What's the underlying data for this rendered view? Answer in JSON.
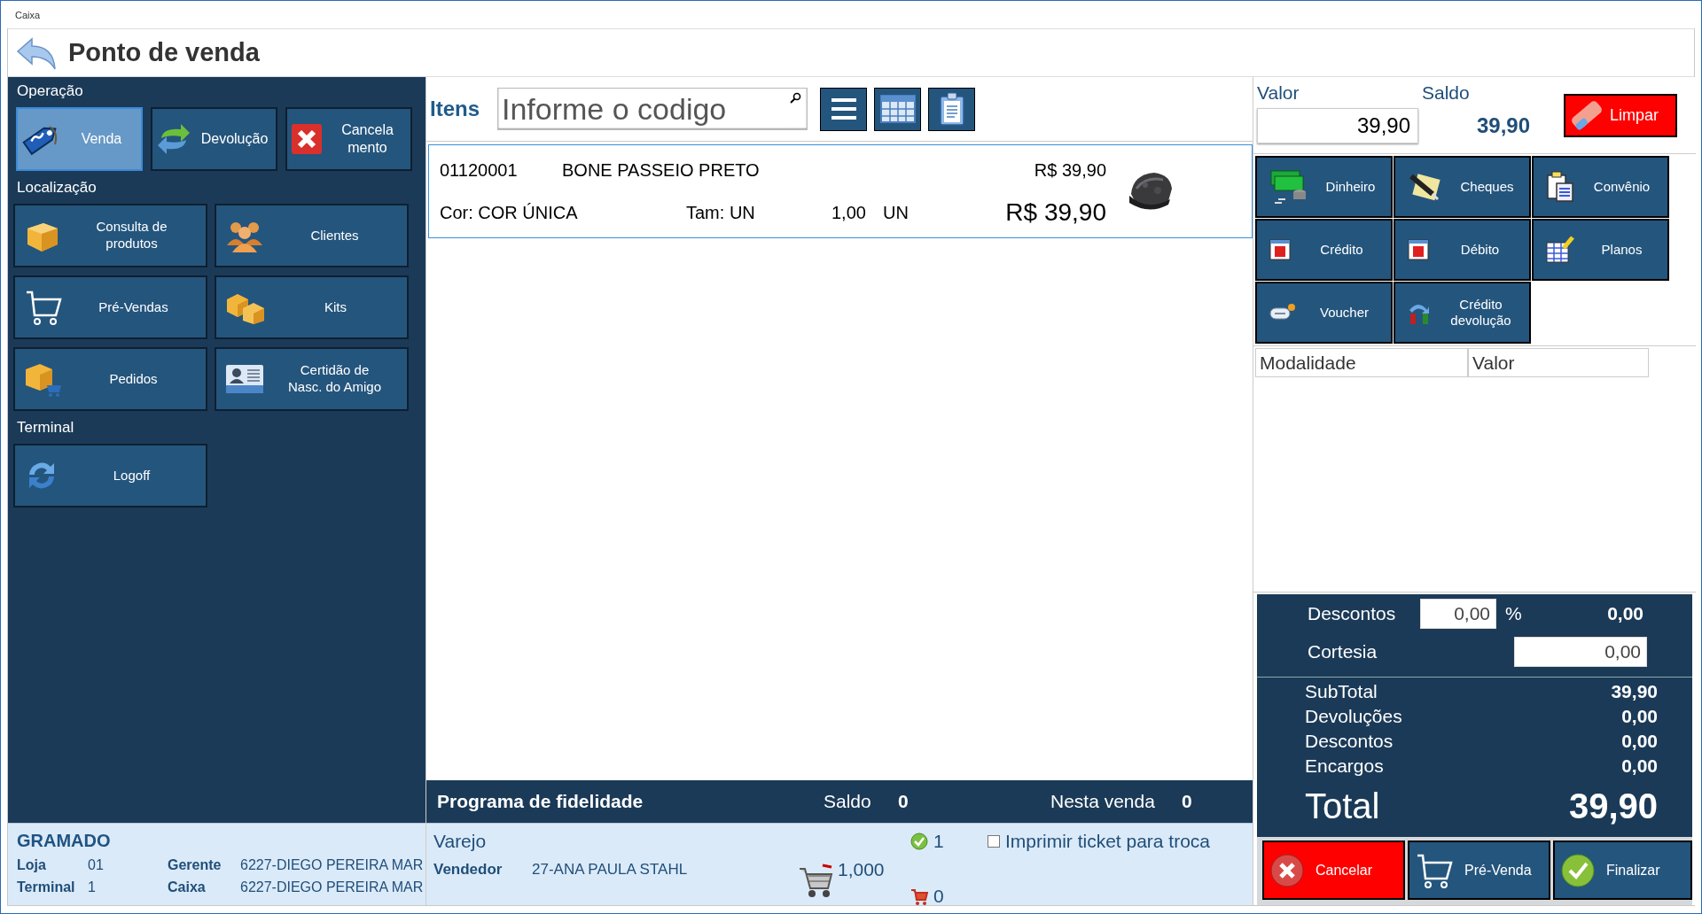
{
  "window": {
    "title": "Caixa"
  },
  "header": {
    "title": "Ponto de venda"
  },
  "sidebar": {
    "sections": [
      {
        "title": "Operação",
        "buttons": [
          {
            "label": "Venda",
            "selected": true
          },
          {
            "label": "Devolução",
            "selected": false
          },
          {
            "label": "Cancela\nmento",
            "selected": false
          }
        ]
      },
      {
        "title": "Localização",
        "buttons": [
          {
            "label": "Consulta de\nprodutos",
            "selected": false
          },
          {
            "label": "Pré-Vendas",
            "selected": false
          },
          {
            "label": "Pedidos",
            "selected": false
          },
          {
            "label": "Clientes",
            "selected": false
          },
          {
            "label": "Kits",
            "selected": false
          },
          {
            "label": "Certidão de\nNasc. do Amigo",
            "selected": false
          }
        ]
      },
      {
        "title": "Terminal",
        "buttons": [
          {
            "label": "Logoff",
            "selected": false
          }
        ]
      }
    ]
  },
  "store": {
    "name": "GRAMADO",
    "fields": [
      {
        "label": "Loja",
        "value": "01"
      },
      {
        "label": "Gerente",
        "value": "6227-DIEGO PEREIRA MAR"
      },
      {
        "label": "Terminal",
        "value": "1"
      },
      {
        "label": "Caixa",
        "value": "6227-DIEGO PEREIRA MAR"
      }
    ]
  },
  "items": {
    "title": "Itens",
    "search": {
      "placeholder": "Informe o codigo"
    },
    "rows": [
      {
        "code": "01120001",
        "description": "BONE PASSEIO PRETO",
        "unit_price": "R$ 39,90",
        "variant": "Cor: COR ÚNICA",
        "size": "Tam: UN",
        "quantity": "1,00",
        "unit": "UN",
        "total": "R$ 39,90",
        "selected": true
      }
    ]
  },
  "loyalty": {
    "title": "Programa de fidelidade",
    "balance_label": "Saldo",
    "balance": "0",
    "sale_label": "Nesta venda",
    "sale": "0"
  },
  "sale": {
    "price_table": "Varejo",
    "seller_label": "Vendedor",
    "seller": "27-ANA PAULA STAHL",
    "quantity": "1,000",
    "done_count": "1",
    "pending_count": "0",
    "print_ticket": {
      "label": "Imprimir ticket para troca",
      "checked": false
    }
  },
  "payment": {
    "value_label": "Valor",
    "value": "39,90",
    "balance_label": "Saldo",
    "balance": "39,90",
    "clear_button": "Limpar",
    "methods": [
      "Dinheiro",
      "Cheques",
      "Convênio",
      "Crédito",
      "Débito",
      "Planos",
      "Voucher",
      "Crédito\ndevolução"
    ],
    "columns": [
      "Modalidade",
      "Valor"
    ]
  },
  "discounts": {
    "discount_label": "Descontos",
    "discount_percent": "0,00",
    "percent_sign": "%",
    "discount_value": "0,00",
    "courtesy_label": "Cortesia",
    "courtesy_value": "0,00"
  },
  "totals": {
    "rows": [
      {
        "label": "SubTotal",
        "value": "39,90"
      },
      {
        "label": "Devoluções",
        "value": "0,00"
      },
      {
        "label": "Descontos",
        "value": "0,00"
      },
      {
        "label": "Encargos",
        "value": "0,00"
      }
    ],
    "total": {
      "label": "Total",
      "value": "39,90"
    }
  },
  "actions": [
    {
      "label": "Cancelar",
      "kind": "danger"
    },
    {
      "label": "Pré-Venda",
      "kind": "normal"
    },
    {
      "label": "Finalizar",
      "kind": "normal"
    }
  ]
}
